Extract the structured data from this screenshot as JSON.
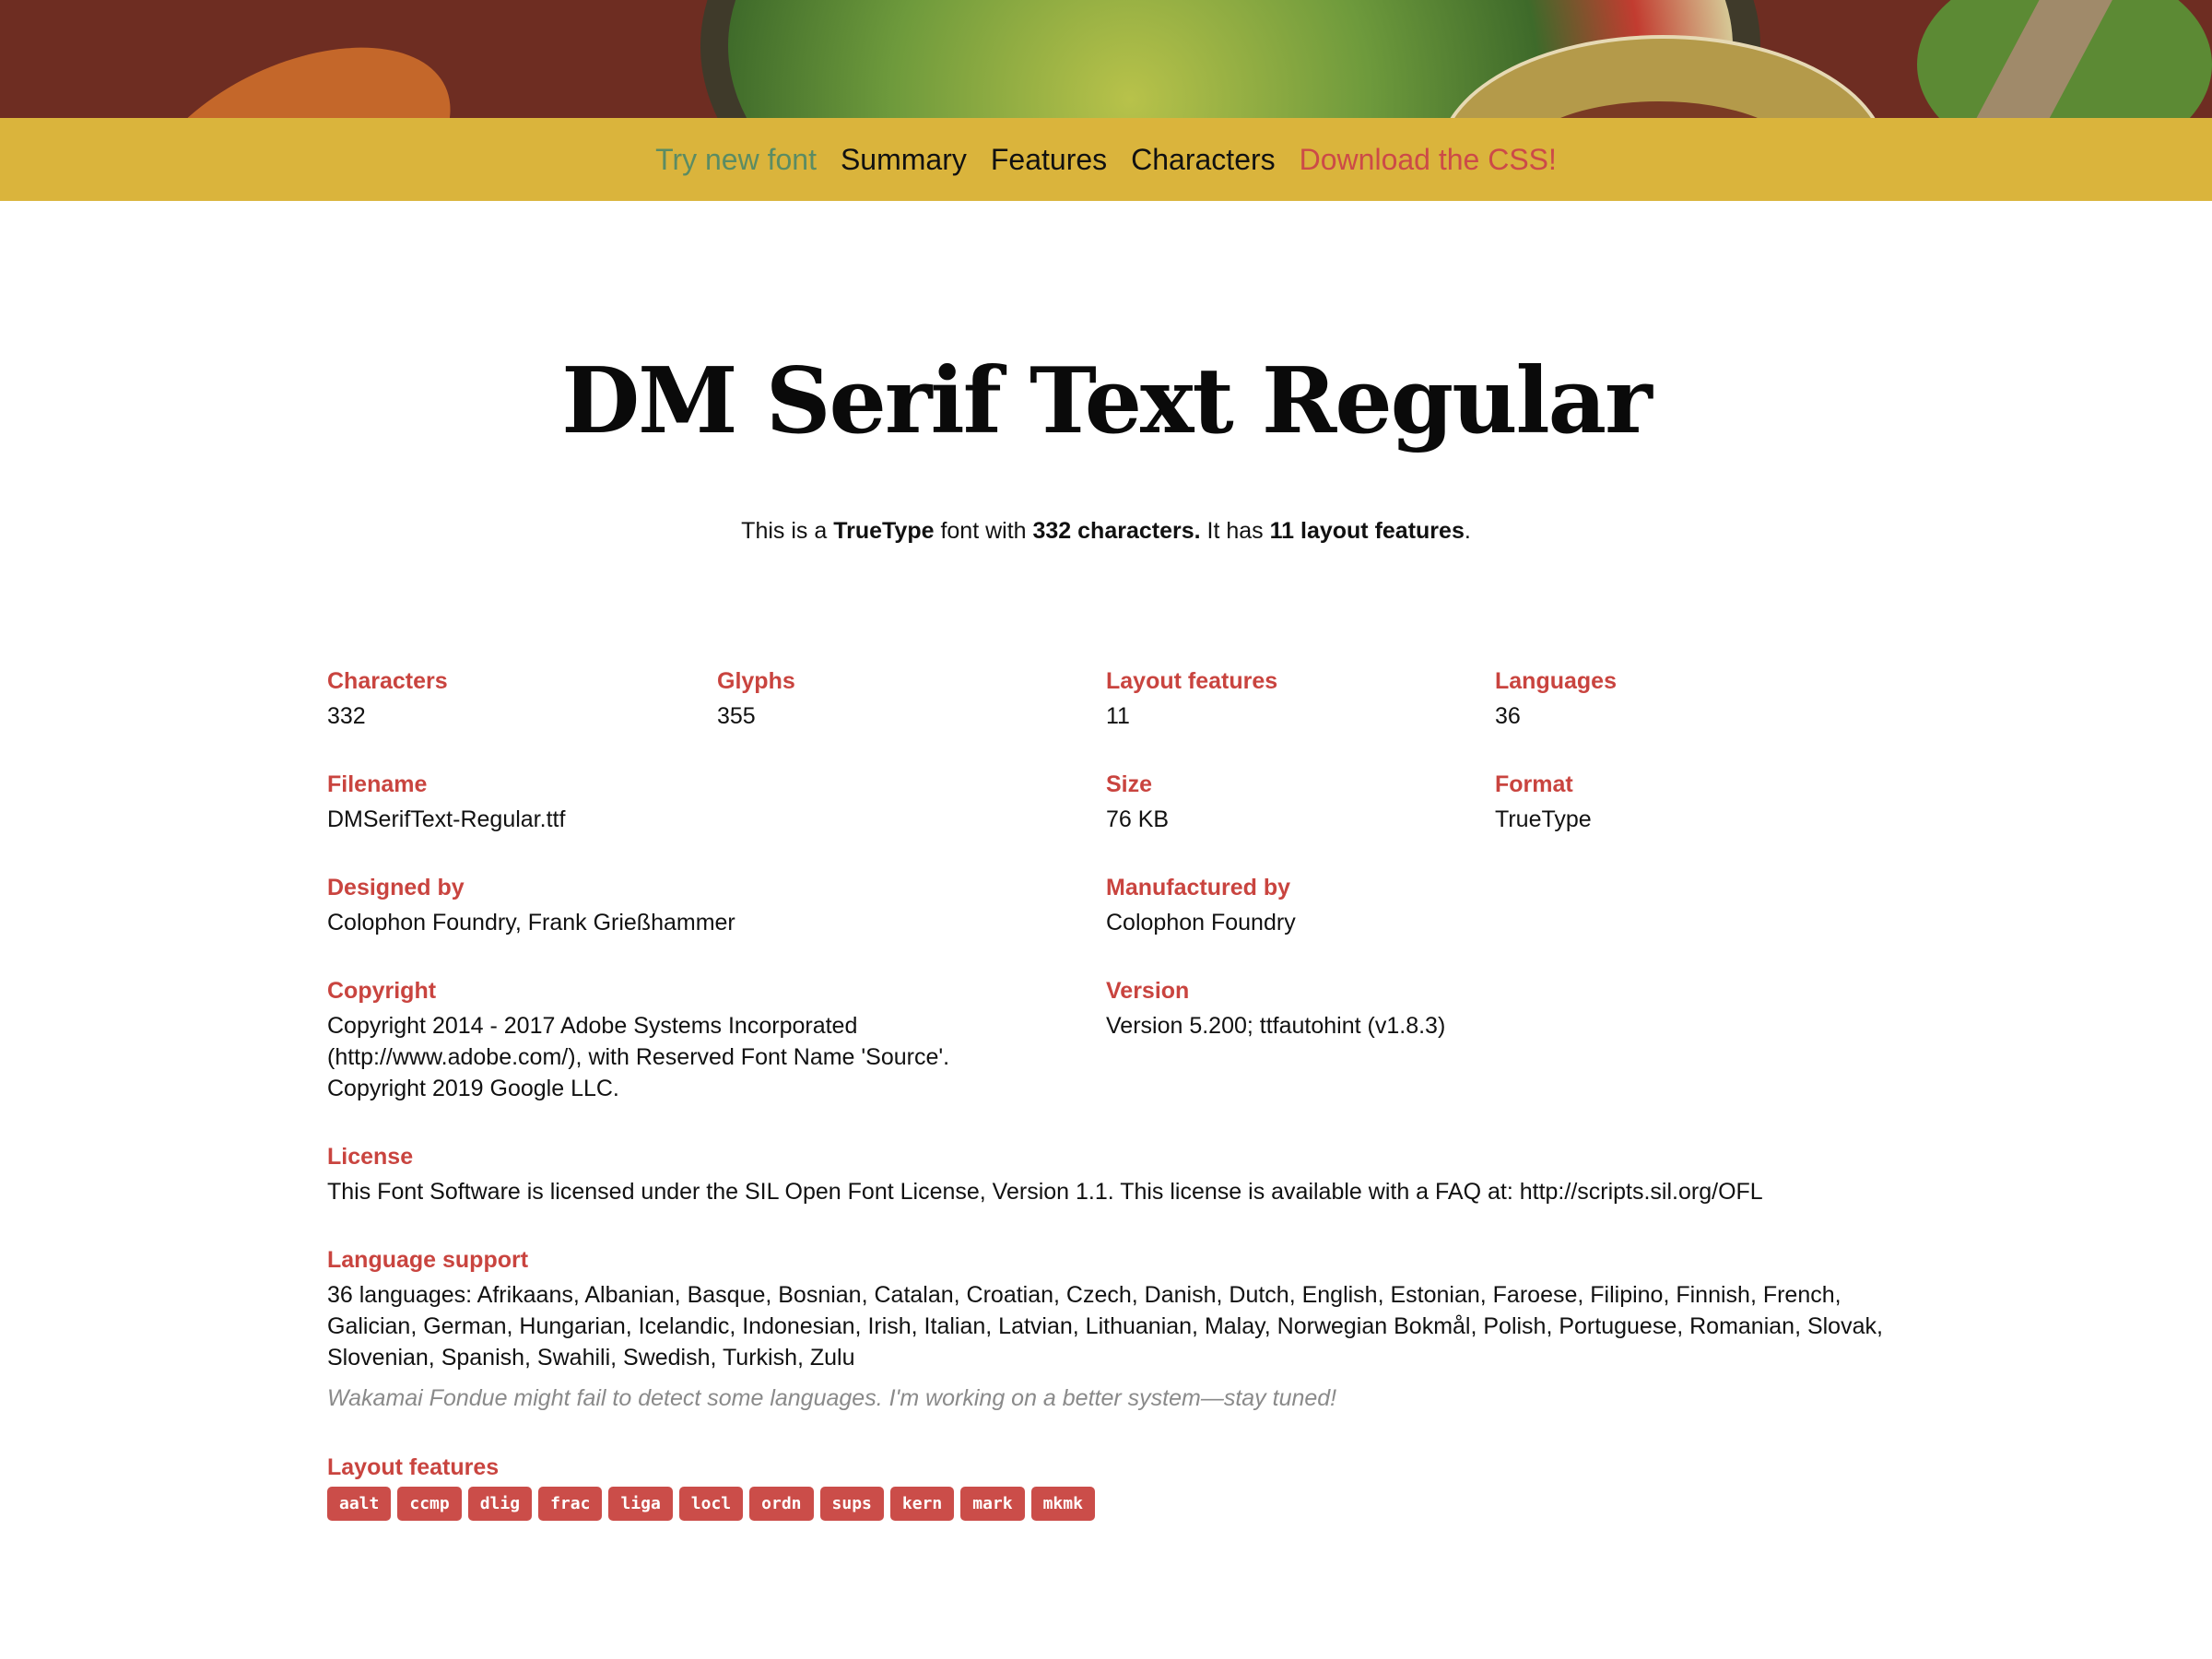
{
  "nav": {
    "items": [
      {
        "label": "Try new font",
        "color": "#5b8c63"
      },
      {
        "label": "Summary"
      },
      {
        "label": "Features"
      },
      {
        "label": "Characters"
      },
      {
        "label": "Download the CSS!",
        "color": "#cc4a48"
      }
    ]
  },
  "title": "DM Serif Text Regular",
  "subtitle": {
    "p1": "This is a ",
    "format": "TrueType",
    "p2": " font with ",
    "chars": "332 characters.",
    "p3": " It has ",
    "features": "11 layout features",
    "p4": "."
  },
  "summary": {
    "characters": {
      "label": "Characters",
      "value": "332"
    },
    "glyphs": {
      "label": "Glyphs",
      "value": "355"
    },
    "layout_features": {
      "label": "Layout features",
      "value": "11"
    },
    "languages": {
      "label": "Languages",
      "value": "36"
    },
    "filename": {
      "label": "Filename",
      "value": "DMSerifText-Regular.ttf"
    },
    "size": {
      "label": "Size",
      "value": "76 KB"
    },
    "format": {
      "label": "Format",
      "value": "TrueType"
    },
    "designed_by": {
      "label": "Designed by",
      "value": "Colophon Foundry, Frank Grießhammer"
    },
    "manufactured_by": {
      "label": "Manufactured by",
      "value": "Colophon Foundry"
    },
    "copyright": {
      "label": "Copyright",
      "lines": [
        "Copyright 2014 - 2017 Adobe Systems Incorporated",
        "(http://www.adobe.com/), with Reserved Font Name 'Source'.",
        "Copyright 2019 Google LLC."
      ]
    },
    "version": {
      "label": "Version",
      "value": "Version 5.200; ttfautohint (v1.8.3)"
    },
    "license": {
      "label": "License",
      "value": "This Font Software is licensed under the SIL Open Font License, Version 1.1. This license is available with a FAQ at: http://scripts.sil.org/OFL"
    },
    "language_support": {
      "label": "Language support",
      "lines": [
        "36 languages: Afrikaans, Albanian, Basque, Bosnian, Catalan, Croatian, Czech, Danish, Dutch, English, Estonian, Faroese, Filipino, Finnish, French,",
        "Galician, German, Hungarian, Icelandic, Indonesian, Irish, Italian, Latvian, Lithuanian, Malay, Norwegian Bokmål, Polish, Portuguese, Romanian, Slovak,",
        "Slovenian, Spanish, Swahili, Swedish, Turkish, Zulu"
      ],
      "note": "Wakamai Fondue might fail to detect some languages. I'm working on a better system—stay tuned!"
    },
    "feature_list": {
      "label": "Layout features",
      "tags": [
        "aalt",
        "ccmp",
        "dlig",
        "frac",
        "liga",
        "locl",
        "ordn",
        "sups",
        "kern",
        "mark",
        "mkmk"
      ]
    }
  },
  "colors": {
    "nav_bg": "#dab43c",
    "label": "#c9443f",
    "badge": "#cb4d49",
    "note": "#8a8a8a"
  }
}
